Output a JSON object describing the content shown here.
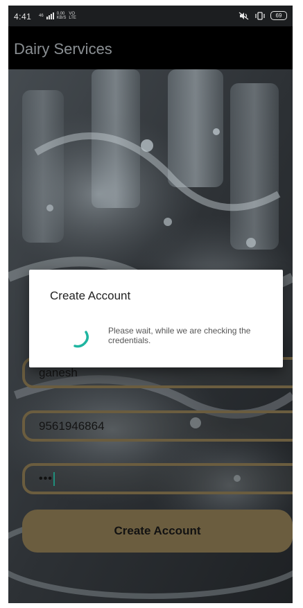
{
  "status_bar": {
    "time": "4:41",
    "net_top": "46",
    "speed_value": "0.00",
    "speed_unit": "KB/S",
    "vo": "VO",
    "lte": "LTE",
    "battery": "69"
  },
  "app_bar": {
    "title": "Dairy Services"
  },
  "form": {
    "name_value": "ganesh",
    "phone_value": "9561946864",
    "password_mask": "•••",
    "submit_label": "Create Account"
  },
  "dialog": {
    "title": "Create Account",
    "message": "Please wait, while we are checking the credentials.",
    "spinner_icon": "loading-spinner-icon",
    "accent_color": "#1fb5a0"
  },
  "colors": {
    "field_border": "#6b5d3f",
    "button_bg": "#6b5d3f",
    "app_bar_bg": "#000000",
    "app_title": "#8a8f93"
  }
}
